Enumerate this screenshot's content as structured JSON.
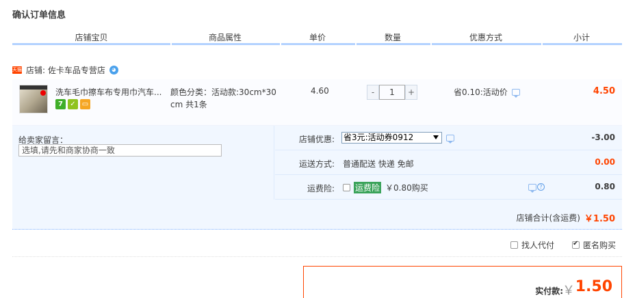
{
  "page_title": "确认订单信息",
  "columns": [
    "店铺宝贝",
    "商品属性",
    "单价",
    "数量",
    "优惠方式",
    "小计"
  ],
  "shop": {
    "badge": "天猫",
    "label": "店铺: 佐卡车品专营店"
  },
  "item": {
    "title": "洗车毛巾擦车布专用巾汽车...",
    "attr": "颜色分类：活动款:30cm*30cm 共1条",
    "price": "4.60",
    "qty_minus": "-",
    "qty": "1",
    "qty_plus": "+",
    "promo": "省0.10:活动价",
    "subtotal": "4.50",
    "service_icons": [
      "seven-day-return-icon",
      "guarantee-icon",
      "card-pay-icon"
    ]
  },
  "memo": {
    "label": "给卖家留言：",
    "placeholder": "选填,请先和商家协商一致"
  },
  "coupon": {
    "label": "店铺优惠:",
    "selected": "省3元:活动券0912",
    "value": "-3.00"
  },
  "shipping": {
    "label": "运送方式:",
    "text": "普通配送 快递 免邮",
    "value": "0.00"
  },
  "insurance": {
    "label": "运费险:",
    "tag": "运费险",
    "text": "￥0.80购买",
    "value": "0.80"
  },
  "shop_total": {
    "label": "店铺合计(含运费)",
    "amount": "￥1.50"
  },
  "options": {
    "proxy_pay": "找人代付",
    "anonymous": "匿名购买"
  },
  "payment": {
    "label": "实付款:",
    "currency": "￥",
    "amount": "1.50"
  },
  "colors": {
    "accent": "#ff4400",
    "header_border": "#b2d1ff",
    "panel_bg": "#f1f7ff"
  }
}
